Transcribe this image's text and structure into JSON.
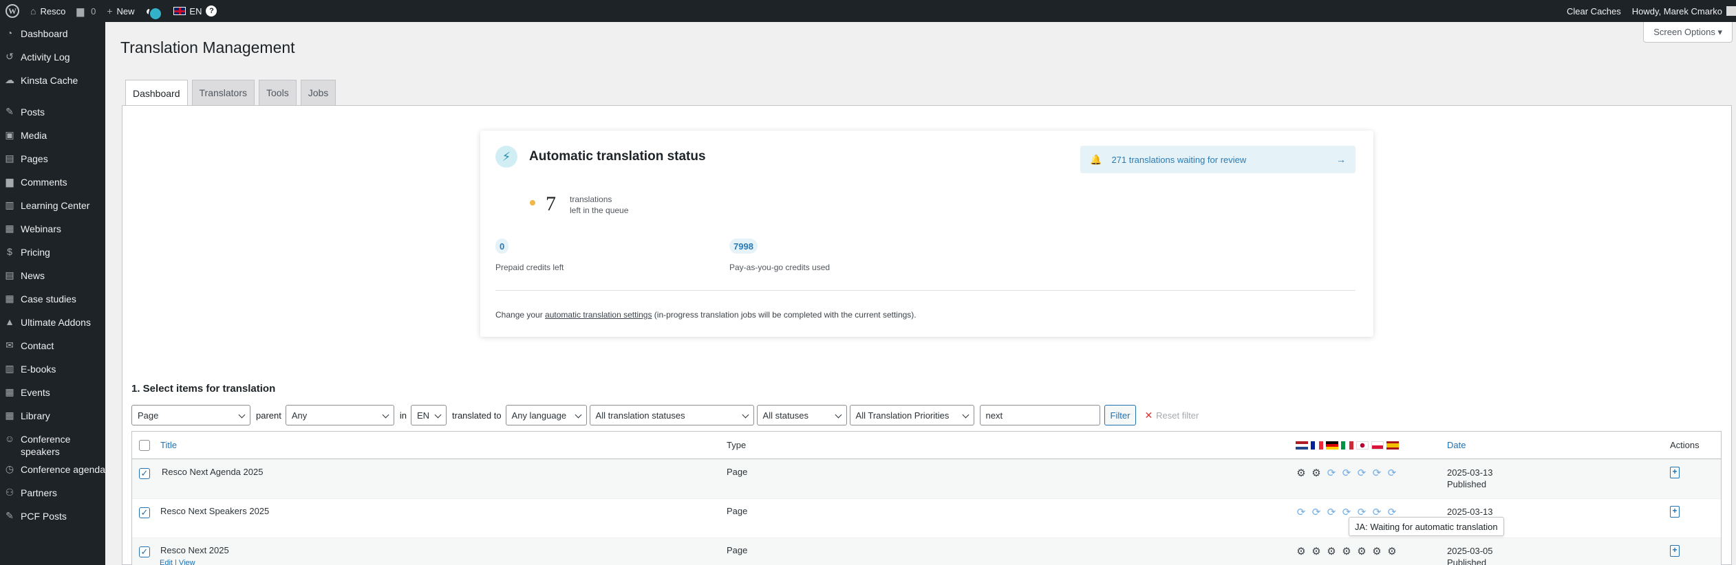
{
  "adminbar": {
    "site_name": "Resco",
    "comments_count": "0",
    "new_label": "New",
    "language": "EN",
    "help": "?",
    "clear_caches": "Clear Caches",
    "howdy": "Howdy, Marek Cmarko"
  },
  "sidebar": {
    "items": [
      {
        "label": "Dashboard",
        "icon": "dashboard-icon"
      },
      {
        "label": "Activity Log",
        "icon": "history-icon"
      },
      {
        "label": "Kinsta Cache",
        "icon": "cloud-icon"
      },
      {
        "label": "Posts",
        "icon": "pin-icon"
      },
      {
        "label": "Media",
        "icon": "media-icon"
      },
      {
        "label": "Pages",
        "icon": "pages-icon"
      },
      {
        "label": "Comments",
        "icon": "comment-icon"
      },
      {
        "label": "Learning Center",
        "icon": "book-icon"
      },
      {
        "label": "Webinars",
        "icon": "grid-icon"
      },
      {
        "label": "Pricing",
        "icon": "dollar-icon"
      },
      {
        "label": "News",
        "icon": "pages-icon"
      },
      {
        "label": "Case studies",
        "icon": "grid-icon"
      },
      {
        "label": "Ultimate Addons",
        "icon": "chart-icon"
      },
      {
        "label": "Contact",
        "icon": "mail-icon"
      },
      {
        "label": "E-books",
        "icon": "book-icon"
      },
      {
        "label": "Events",
        "icon": "grid-icon"
      },
      {
        "label": "Library",
        "icon": "grid-icon"
      },
      {
        "label": "Conference speakers",
        "icon": "person-icon"
      },
      {
        "label": "Conference agenda",
        "icon": "clock-icon"
      },
      {
        "label": "Partners",
        "icon": "people-icon"
      },
      {
        "label": "PCF Posts",
        "icon": "pin-icon"
      }
    ]
  },
  "page": {
    "title": "Translation Management",
    "screen_options": "Screen Options ▾"
  },
  "tabs": [
    {
      "label": "Dashboard",
      "active": true
    },
    {
      "label": "Translators",
      "active": false
    },
    {
      "label": "Tools",
      "active": false
    },
    {
      "label": "Jobs",
      "active": false
    }
  ],
  "status_card": {
    "title": "Automatic translation status",
    "review_text": "271 translations waiting for review",
    "queue_count": "7",
    "queue_label_1": "translations",
    "queue_label_2": "left in the queue",
    "prepaid_value": "0",
    "prepaid_label": "Prepaid credits left",
    "payg_value": "7998",
    "payg_label": "Pay-as-you-go credits used",
    "footer_pre": "Change your ",
    "footer_link": "automatic translation settings",
    "footer_post": " (in-progress translation jobs will be completed with the current settings)."
  },
  "section": {
    "title": "1. Select items for translation"
  },
  "filters": {
    "type": "Page",
    "parent_label": "parent",
    "parent": "Any",
    "in_label": "in",
    "lang": "EN",
    "translated_to_label": "translated to",
    "target": "Any language",
    "tr_status": "All translation statuses",
    "status": "All statuses",
    "priority": "All Translation Priorities",
    "search_value": "next",
    "filter_btn": "Filter",
    "reset": "Reset filter"
  },
  "table": {
    "headers": {
      "title": "Title",
      "type": "Type",
      "date": "Date",
      "actions": "Actions"
    },
    "flag_colors": {
      "nl": [
        "#ae1c28",
        "#ffffff",
        "#21468b"
      ],
      "fr": [
        "#002395",
        "#ffffff",
        "#ed2939"
      ],
      "de": [
        "#000000",
        "#dd0000",
        "#ffce00"
      ],
      "it": [
        "#009246",
        "#ffffff",
        "#ce2b37"
      ],
      "jp": [
        "#ffffff",
        "#bc002d"
      ],
      "pl": [
        "#ffffff",
        "#dc143c"
      ],
      "es": [
        "#aa151b",
        "#f1bf00",
        "#aa151b"
      ]
    },
    "rows": [
      {
        "title": "Resco Next Agenda 2025",
        "type": "Page",
        "date": "2025-03-13",
        "status": "Published",
        "langs": [
          "done",
          "done",
          "wait",
          "wait",
          "wait",
          "wait",
          "wait"
        ]
      },
      {
        "title": "Resco Next Speakers 2025",
        "type": "Page",
        "date": "2025-03-13",
        "status": "",
        "langs": [
          "wait",
          "wait",
          "wait",
          "wait",
          "wait",
          "wait",
          "wait"
        ]
      },
      {
        "title": "Resco Next 2025",
        "type": "Page",
        "date": "2025-03-05",
        "status": "Published",
        "langs": [
          "done",
          "done",
          "done",
          "done",
          "done",
          "done",
          "done"
        ],
        "row_actions": "Edit | View"
      }
    ]
  },
  "tooltip": "JA: Waiting for automatic translation"
}
